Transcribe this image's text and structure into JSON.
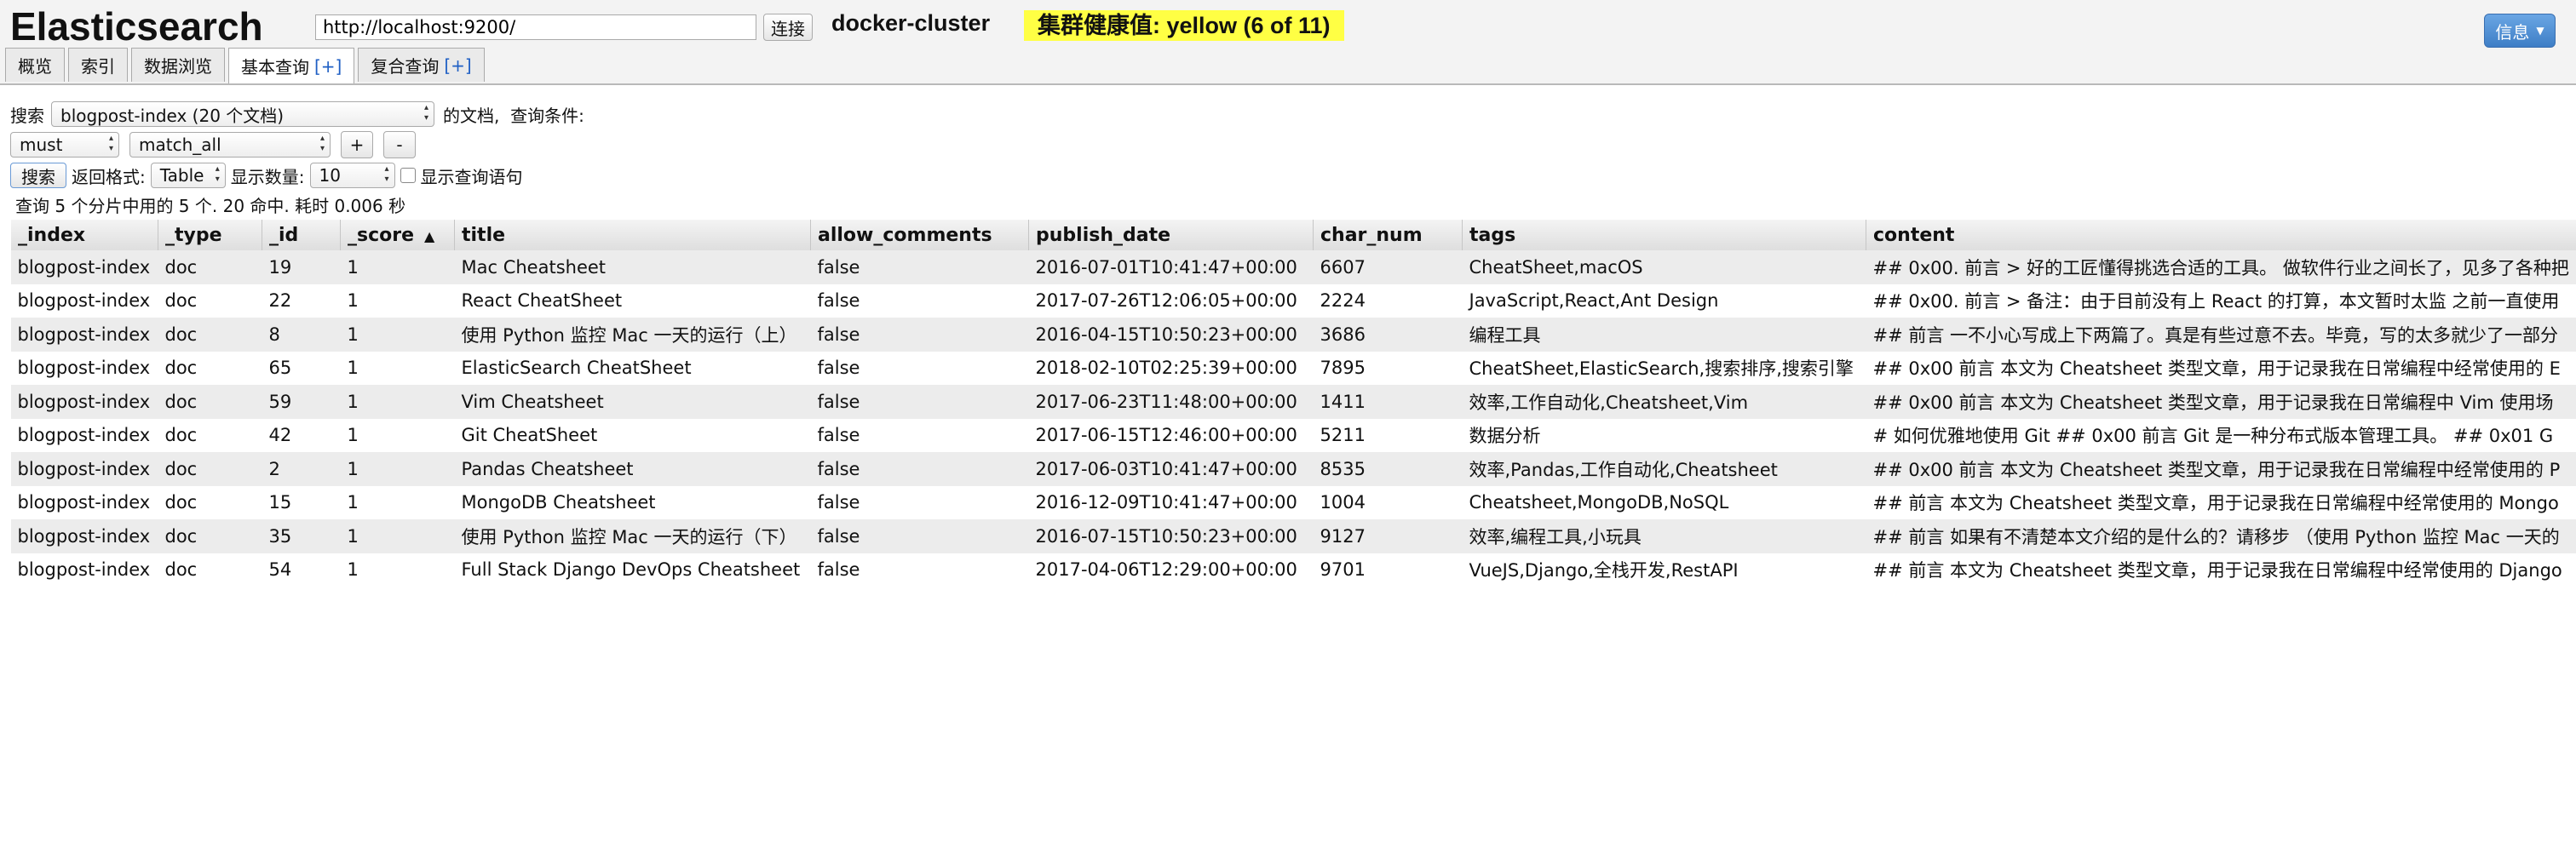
{
  "header": {
    "logo": "Elasticsearch",
    "url": "http://localhost:9200/",
    "connect_label": "连接",
    "cluster_name": "docker-cluster",
    "health": "集群健康值: yellow (6 of 11)",
    "info_label": "信息"
  },
  "tabs": [
    {
      "label": "概览",
      "plus": ""
    },
    {
      "label": "索引",
      "plus": ""
    },
    {
      "label": "数据浏览",
      "plus": ""
    },
    {
      "label": "基本查询",
      "plus": "[+]"
    },
    {
      "label": "复合查询",
      "plus": "[+]"
    }
  ],
  "query": {
    "search_label": "搜索",
    "index_select": "blogpost-index (20 个文档)",
    "docs_label": "的文档,  查询条件:",
    "bool_select": "must",
    "field_select": "match_all",
    "add_label": "+",
    "remove_label": "-",
    "search_button": "搜索",
    "format_label": "返回格式:",
    "format_select": "Table",
    "count_label": "显示数量:",
    "count_select": "10",
    "show_query_label": "显示查询语句"
  },
  "status": "查询 5 个分片中用的 5 个. 20 命中. 耗时 0.006 秒",
  "table": {
    "columns": [
      "_index",
      "_type",
      "_id",
      "_score",
      "title",
      "allow_comments",
      "publish_date",
      "char_num",
      "tags",
      "content"
    ],
    "sorted_column": "_score",
    "rows": [
      [
        "blogpost-index",
        "doc",
        "19",
        "1",
        "Mac Cheatsheet",
        "false",
        "2016-07-01T10:41:47+00:00",
        "6607",
        "CheatSheet,macOS",
        "## 0x00. 前言 > 好的工匠懂得挑选合适的工具。 做软件行业之间长了，见多了各种把"
      ],
      [
        "blogpost-index",
        "doc",
        "22",
        "1",
        "React CheatSheet",
        "false",
        "2017-07-26T12:06:05+00:00",
        "2224",
        "JavaScript,React,Ant Design",
        "## 0x00. 前言 > 备注：由于目前没有上 React 的打算，本文暂时太监 之前一直使用"
      ],
      [
        "blogpost-index",
        "doc",
        "8",
        "1",
        "使用 Python 监控 Mac 一天的运行（上）",
        "false",
        "2016-04-15T10:50:23+00:00",
        "3686",
        "编程工具",
        "## 前言 一不小心写成上下两篇了。真是有些过意不去。毕竟，写的太多就少了一部分"
      ],
      [
        "blogpost-index",
        "doc",
        "65",
        "1",
        "ElasticSearch CheatSheet",
        "false",
        "2018-02-10T02:25:39+00:00",
        "7895",
        "CheatSheet,ElasticSearch,搜索排序,搜索引擎",
        "## 0x00 前言 本文为 Cheatsheet 类型文章，用于记录我在日常编程中经常使用的 E"
      ],
      [
        "blogpost-index",
        "doc",
        "59",
        "1",
        "Vim Cheatsheet",
        "false",
        "2017-06-23T11:48:00+00:00",
        "1411",
        "效率,工作自动化,Cheatsheet,Vim",
        "## 0x00 前言 本文为 Cheatsheet 类型文章，用于记录我在日常编程中 Vim 使用场"
      ],
      [
        "blogpost-index",
        "doc",
        "42",
        "1",
        "Git CheatSheet",
        "false",
        "2017-06-15T12:46:00+00:00",
        "5211",
        "数据分析",
        "# 如何优雅地使用 Git ## 0x00 前言 Git 是一种分布式版本管理工具。 ## 0x01 G"
      ],
      [
        "blogpost-index",
        "doc",
        "2",
        "1",
        "Pandas Cheatsheet",
        "false",
        "2017-06-03T10:41:47+00:00",
        "8535",
        "效率,Pandas,工作自动化,Cheatsheet",
        "## 0x00 前言 本文为 Cheatsheet 类型文章，用于记录我在日常编程中经常使用的 P"
      ],
      [
        "blogpost-index",
        "doc",
        "15",
        "1",
        "MongoDB Cheatsheet",
        "false",
        "2016-12-09T10:41:47+00:00",
        "1004",
        "Cheatsheet,MongoDB,NoSQL",
        "## 前言 本文为 Cheatsheet 类型文章，用于记录我在日常编程中经常使用的 Mongo"
      ],
      [
        "blogpost-index",
        "doc",
        "35",
        "1",
        "使用 Python 监控 Mac 一天的运行（下）",
        "false",
        "2016-07-15T10:50:23+00:00",
        "9127",
        "效率,编程工具,小玩具",
        "## 前言 如果有不清楚本文介绍的是什么的？请移步 （使用 Python 监控 Mac 一天的"
      ],
      [
        "blogpost-index",
        "doc",
        "54",
        "1",
        "Full Stack Django DevOps Cheatsheet",
        "false",
        "2017-04-06T12:29:00+00:00",
        "9701",
        "VueJS,Django,全栈开发,RestAPI",
        "## 前言 本文为 Cheatsheet 类型文章，用于记录我在日常编程中经常使用的 Django"
      ]
    ]
  }
}
